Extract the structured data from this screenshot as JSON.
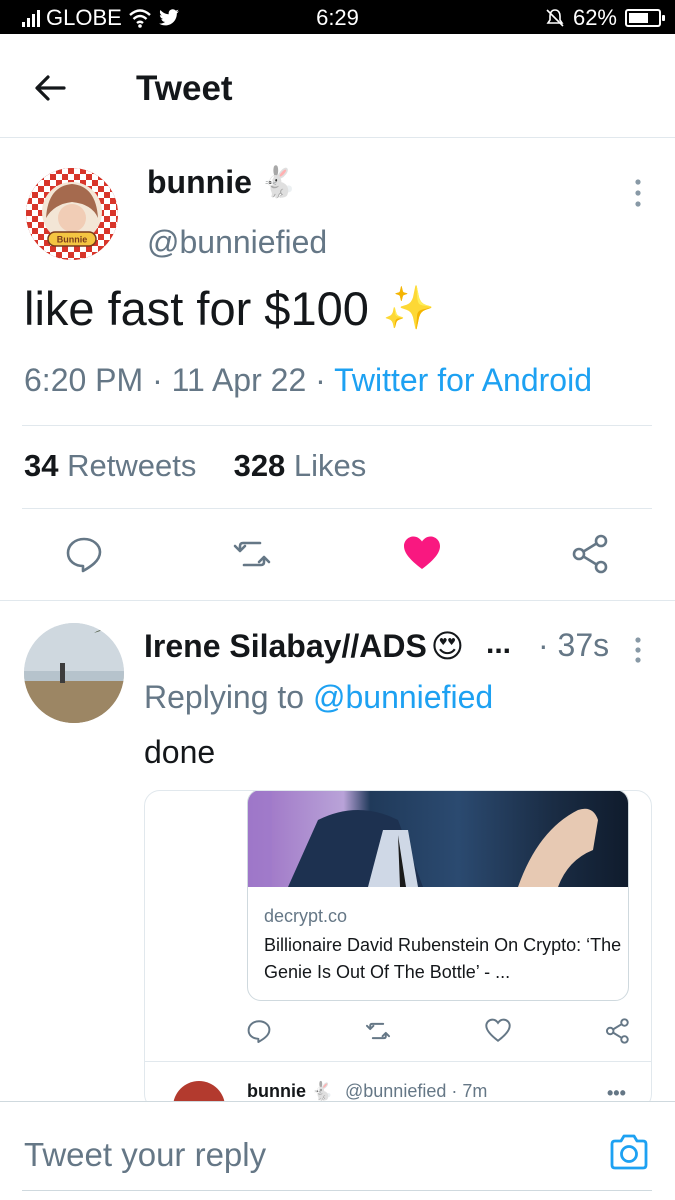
{
  "status_bar": {
    "carrier": "GLOBE",
    "time": "6:29",
    "battery": "62%"
  },
  "header": {
    "title": "Tweet"
  },
  "main_tweet": {
    "author_name": "bunnie",
    "author_emoji": "🐇",
    "author_handle": "@bunniefied",
    "avatar_badge": "Bunnie",
    "text": "like fast for $100",
    "emoji": "✨",
    "time": "6:20 PM · 11 Apr 22 · ",
    "source": "Twitter for Android",
    "retweets_count": "34",
    "retweets_label": " Retweets",
    "likes_count": "328",
    "likes_label": " Likes",
    "liked": true,
    "like_color": "#f91880"
  },
  "reply": {
    "author_name": "Irene Silabay//ADS",
    "author_emoji": "😍",
    "truncation": "...",
    "time": "· 37s",
    "replying_prefix": "Replying to ",
    "replying_handle": "@bunniefied",
    "text": "done",
    "link_card": {
      "domain": "decrypt.co",
      "title": "Billionaire David Rubenstein On Crypto: ‘The Genie Is Out Of The Bottle’ - ..."
    },
    "nested": {
      "author_name": "bunnie",
      "author_emoji": "🐇",
      "handle_time": "@bunniefied · 7m",
      "more": "•••"
    }
  },
  "reply_bar": {
    "placeholder": "Tweet your reply"
  },
  "colors": {
    "accent": "#1da1f2",
    "muted": "#657786",
    "border": "#e1e8ed"
  }
}
